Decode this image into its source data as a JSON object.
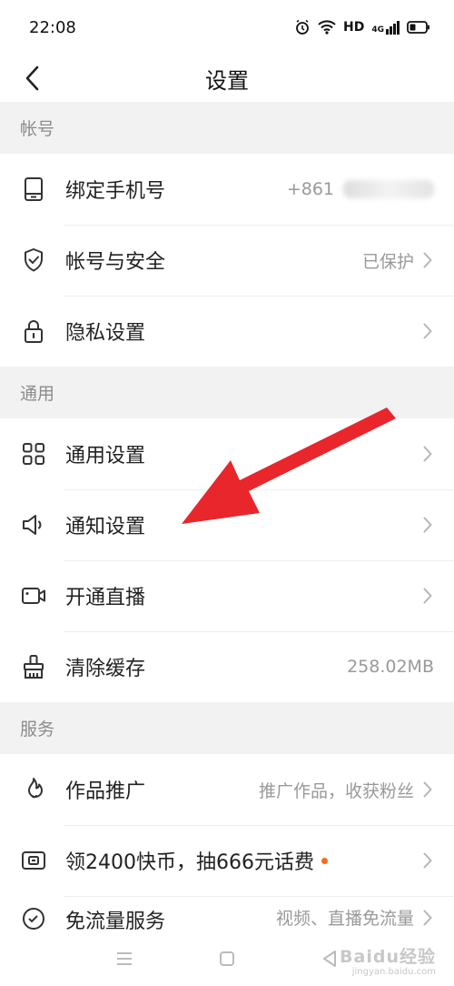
{
  "status_bar": {
    "time": "22:08",
    "hd_label": "HD",
    "signal_label": "4G"
  },
  "nav": {
    "title": "设置"
  },
  "sections": [
    {
      "header": "帐号",
      "items": [
        {
          "label": "绑定手机号",
          "value": "+861",
          "icon": "phone-icon"
        },
        {
          "label": "帐号与安全",
          "value": "已保护",
          "icon": "shield-icon"
        },
        {
          "label": "隐私设置",
          "value": "",
          "icon": "lock-icon"
        }
      ]
    },
    {
      "header": "通用",
      "items": [
        {
          "label": "通用设置",
          "value": "",
          "icon": "grid-icon"
        },
        {
          "label": "通知设置",
          "value": "",
          "icon": "speaker-icon"
        },
        {
          "label": "开通直播",
          "value": "",
          "icon": "camera-icon"
        },
        {
          "label": "清除缓存",
          "value": "258.02MB",
          "icon": "broom-icon"
        }
      ]
    },
    {
      "header": "服务",
      "items": [
        {
          "label": "作品推广",
          "value": "推广作品，收获粉丝",
          "icon": "flame-icon"
        },
        {
          "label": "领2400快币，抽666元话费",
          "value": "",
          "icon": "coin-icon"
        },
        {
          "label": "免流量服务",
          "value": "视频、直播免流量",
          "icon": "data-icon"
        }
      ]
    }
  ],
  "watermark": {
    "brand": "Baidu经验",
    "url": "jingyan.baidu.com"
  },
  "colors": {
    "accent_dot": "#ff6a1a",
    "arrow": "#e8262b",
    "section_bg": "#f2f2f2"
  }
}
